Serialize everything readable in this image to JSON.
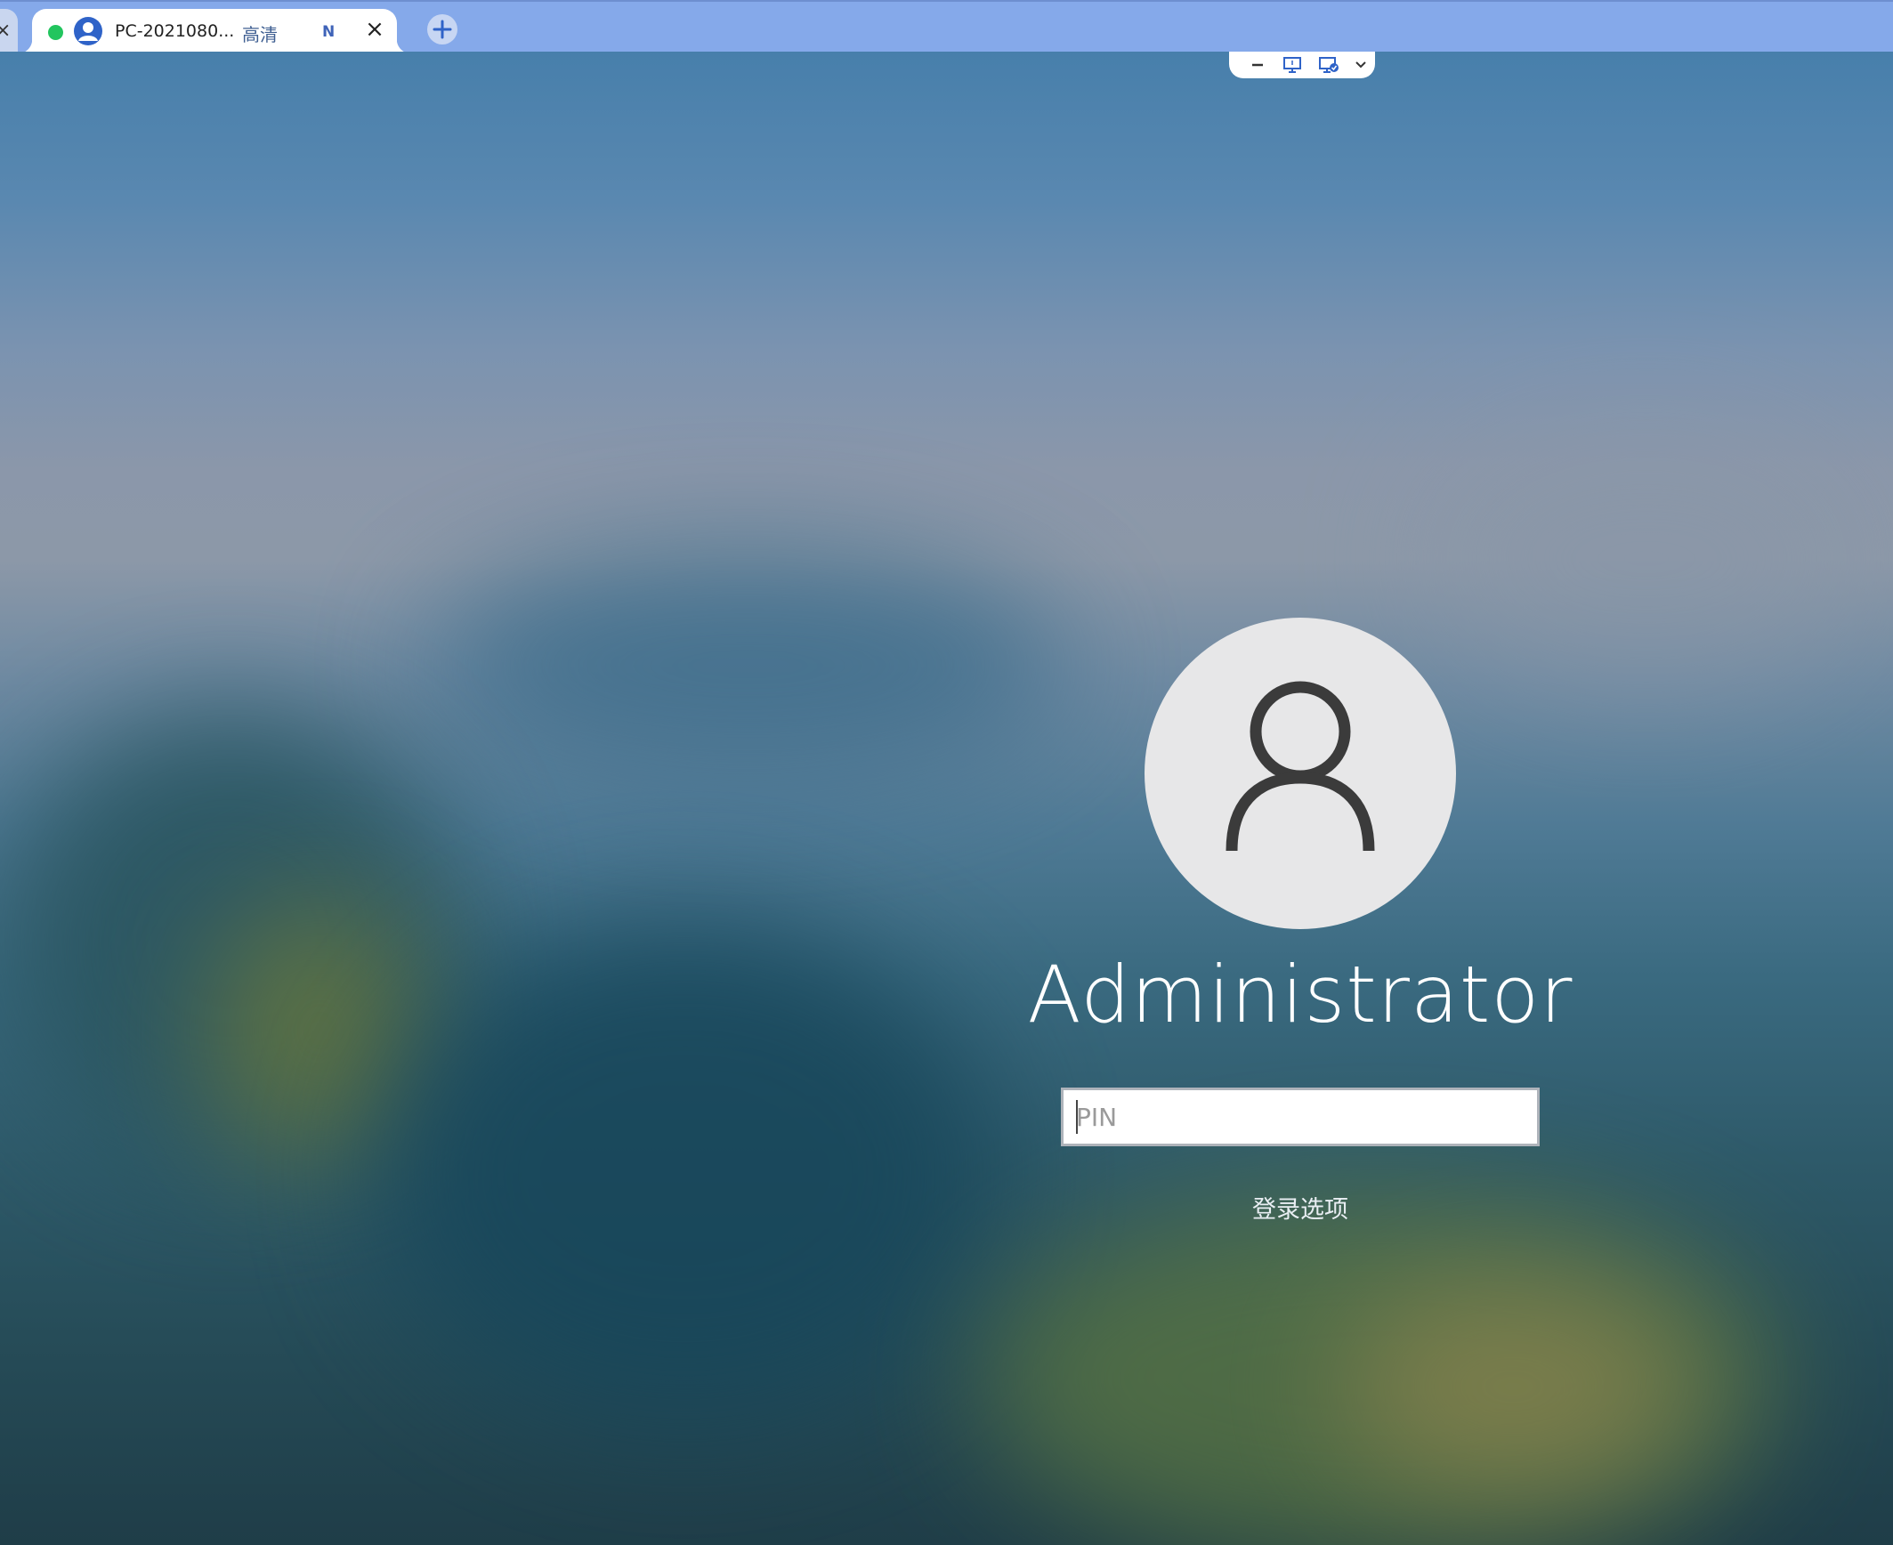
{
  "tabbar": {
    "prev_tab_close": "×",
    "active_tab": {
      "title": "PC-2021080...",
      "quality": "高清",
      "badge": "N",
      "close": "×"
    },
    "new_tab": "+"
  },
  "remote_toolbar": {
    "items": [
      "minimize-icon",
      "monitor-icon",
      "monitor-check-icon",
      "chevron-down-icon"
    ]
  },
  "login": {
    "username": "Administrator",
    "pin_placeholder": "PIN",
    "pin_value": "",
    "sign_in_options": "登录选项"
  },
  "colors": {
    "tabbar_bg": "#85a9ea",
    "status_dot": "#22c55e",
    "accent": "#2f63c8",
    "avatar_bg": "#e7e7e8",
    "avatar_icon": "#3b3b3b"
  }
}
